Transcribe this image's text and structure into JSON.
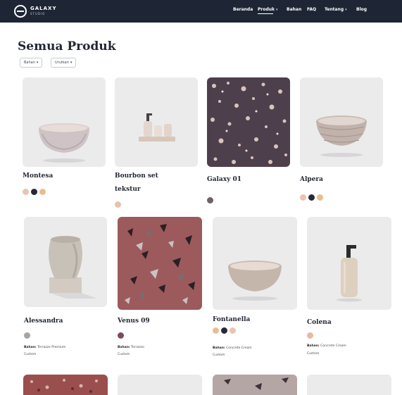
{
  "brand": {
    "name": "GALAXY",
    "sub": "STUDIO"
  },
  "nav": {
    "items": [
      {
        "label": "Beranda",
        "has_caret": false
      },
      {
        "label": "Produk",
        "has_caret": true,
        "active": true
      },
      {
        "label": "Bahan",
        "has_caret": false
      },
      {
        "label": "FAQ",
        "has_caret": false
      },
      {
        "label": "Tentang",
        "has_caret": true
      },
      {
        "label": "Blog",
        "has_caret": false
      }
    ],
    "caret": "▾"
  },
  "page": {
    "title": "Semua Produk"
  },
  "filters": [
    {
      "label": "Bahan",
      "caret": "▾"
    },
    {
      "label": "Urutkan",
      "caret": "▾"
    }
  ],
  "colors": {
    "nav_bg": "#1e2636",
    "card_bg": "#ebebec",
    "terrazzo_dark": "#4e3f4c",
    "terrazzo_red": "#9c5a5c"
  },
  "products": [
    {
      "name": "Montesa",
      "swatches": [
        "#e8c4b2",
        "#262a35",
        "#e9bd93"
      ]
    },
    {
      "name_line1": "Bourbon set",
      "name_line2": "tekstur",
      "swatches": [
        "#e8c0ae"
      ]
    },
    {
      "name": "Galaxy 01",
      "swatches": [
        "#6b6366"
      ]
    },
    {
      "name": "Alpera",
      "swatches": [
        "#e8c4b2",
        "#262a35",
        "#e9bd93"
      ]
    },
    {
      "name": "Alessandra",
      "swatches": [
        "#a9a3a6"
      ],
      "meta_label": "Bahan:",
      "meta_value": "Terrazzo Premium",
      "meta2": "Custom"
    },
    {
      "name": "Venus 09",
      "swatches": [
        "#7c4b5d"
      ],
      "meta_label": "Bahan:",
      "meta_value": "Terrazzo",
      "meta2": "Custom"
    },
    {
      "name": "Fontanella",
      "swatches": [
        "#e9bd93",
        "#262a35",
        "#e8c4b2"
      ],
      "meta_label": "Bahan:",
      "meta_value": "Concrete Cream",
      "meta2": "Custom"
    },
    {
      "name": "Colena",
      "swatches": [
        "#e8b9a4"
      ],
      "meta_label": "Bahan:",
      "meta_value": "Concrete Cream",
      "meta2": "Custom"
    }
  ],
  "icons": {
    "logo": "galaxy-logo-icon"
  }
}
